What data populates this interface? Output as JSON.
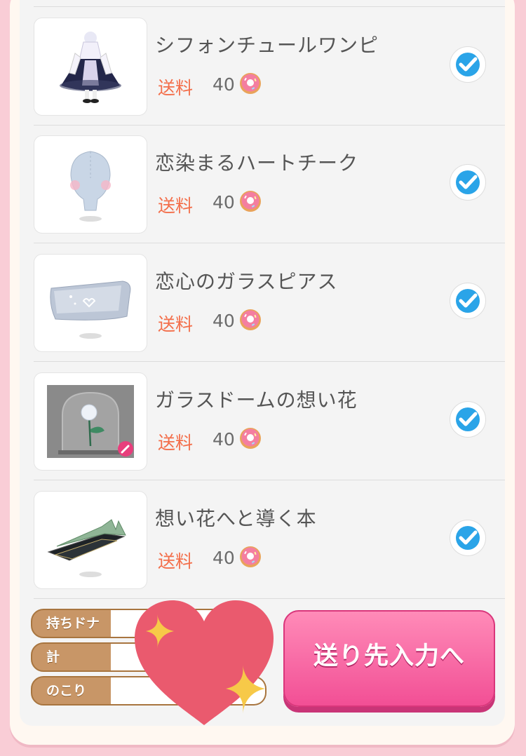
{
  "items": [
    {
      "name": "シフォンチュールワンピ",
      "shipping_label": "送料",
      "cost": "40",
      "icon": "dress",
      "checked": true
    },
    {
      "name": "恋染まるハートチーク",
      "shipping_label": "送料",
      "cost": "40",
      "icon": "face-cheek",
      "checked": true
    },
    {
      "name": "恋心のガラスピアス",
      "shipping_label": "送料",
      "cost": "40",
      "icon": "glass-piercing",
      "checked": true
    },
    {
      "name": "ガラスドームの想い花",
      "shipping_label": "送料",
      "cost": "40",
      "icon": "glass-dome-flower",
      "checked": true
    },
    {
      "name": "想い花へと導く本",
      "shipping_label": "送料",
      "cost": "40",
      "icon": "book",
      "checked": true
    }
  ],
  "footer": {
    "owned_label": "持ちドナ",
    "total_label": "計",
    "remaining_label": "のこり",
    "send_button": "送り先入力へ"
  },
  "colors": {
    "shipping": "#f36e4a",
    "button": "#f24f95",
    "tag": "#c89667",
    "check": "#2aa4e8"
  }
}
